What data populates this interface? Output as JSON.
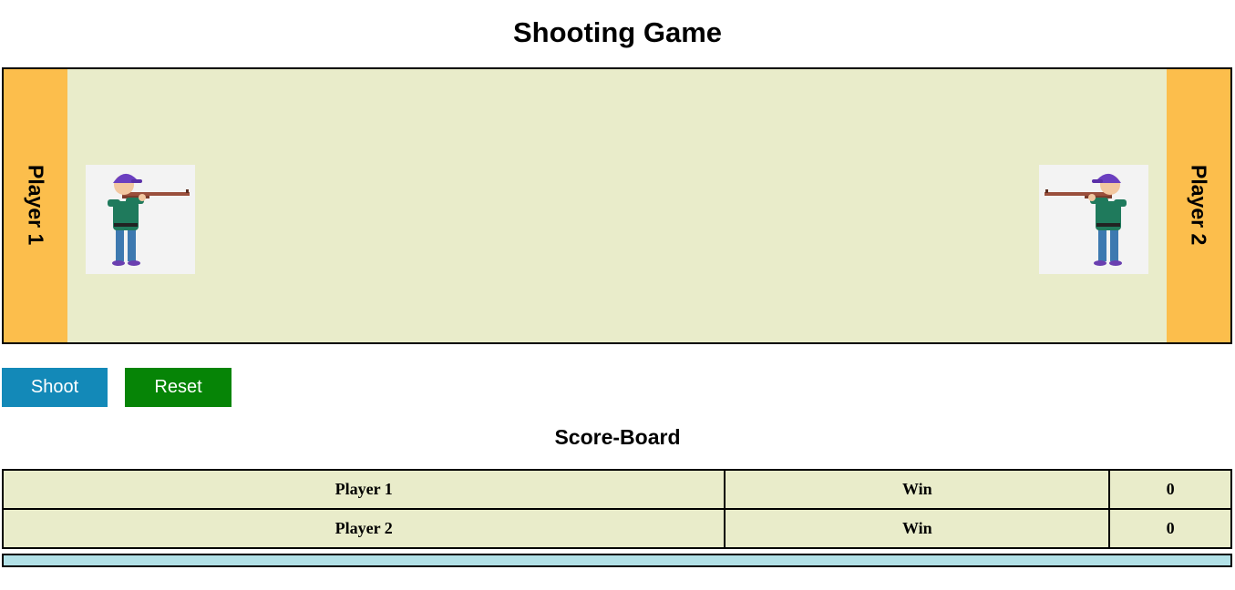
{
  "game": {
    "title": "Shooting Game",
    "player1_label": "Player 1",
    "player2_label": "Player 2",
    "player1_icon": "rifle-shooter-boy",
    "player2_icon": "rifle-shooter-boy"
  },
  "controls": {
    "shoot_label": "Shoot",
    "reset_label": "Reset"
  },
  "scoreboard": {
    "title": "Score-Board",
    "rows": [
      {
        "player": "Player 1",
        "label": "Win",
        "value": "0"
      },
      {
        "player": "Player 2",
        "label": "Win",
        "value": "0"
      }
    ]
  },
  "colors": {
    "arena": "#e9ecca",
    "player_bar": "#fcbe4c",
    "shoot_button": "#1389b8",
    "reset_button": "#068406",
    "bullet_track": "#b2e1e7"
  }
}
